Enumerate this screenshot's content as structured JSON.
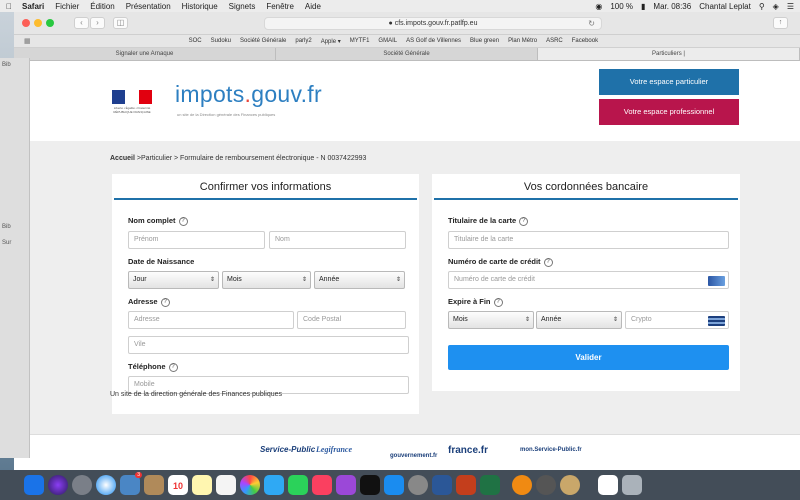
{
  "menubar": {
    "app": "Safari",
    "items": [
      "Fichier",
      "Édition",
      "Présentation",
      "Historique",
      "Signets",
      "Fenêtre",
      "Aide"
    ],
    "battery": "100 %",
    "clock": "Mar. 08:36",
    "user": "Chantal Leplat"
  },
  "browser": {
    "url": "cfs.impots.gouv.fr.patlfp.eu",
    "bookmarks": [
      "SOC",
      "Sudoku",
      "Société Générale",
      "parly2",
      "Apple ▾",
      "MYTF1",
      "GMAIL",
      "AS Golf de Villennes",
      "Blue green",
      "Plan Métro",
      "ASRC",
      "Facebook"
    ],
    "tabs": [
      {
        "label": "Signaler une Arnaque",
        "active": false
      },
      {
        "label": "Société Générale",
        "active": false
      },
      {
        "label": "Particuliers |",
        "active": true
      }
    ]
  },
  "sidebar_labels": [
    "Bib",
    "Bib",
    "Sur"
  ],
  "header": {
    "brand_main": "impots",
    "brand_dot": ".",
    "brand_tld": "gouv.fr",
    "brand_sub": "un site de la Direction générale des Finances publiques",
    "rf_caption": "Liberté • Égalité • Fraternité RÉPUBLIQUE FRANÇAISE",
    "btn_particulier": "Votre espace particulier",
    "btn_professionnel": "Votre espace professionnel"
  },
  "breadcrumb": {
    "home": "Accueil",
    "rest": " >Particulier > Formulaire de remboursement électronique - N 0037422993"
  },
  "left_card": {
    "title": "Confirmer vos informations",
    "nom_label": "Nom complet",
    "prenom_ph": "Prénom",
    "nom_ph": "Nom",
    "dob_label": "Date de Naissance",
    "jour": "Jour",
    "mois": "Mois",
    "annee": "Année",
    "adresse_label": "Adresse",
    "adresse_ph": "Adresse",
    "cp_ph": "Code Postal",
    "ville_ph": "Vile",
    "tel_label": "Téléphone",
    "mobile_ph": "Mobile"
  },
  "right_card": {
    "title": "Vos cordonnées bancaire",
    "titulaire_label": "Titulaire de la carte",
    "titulaire_ph": "Titulaire de la carte",
    "numero_label": "Numéro de carte de crédit",
    "numero_ph": "Numéro de carte de crédit",
    "expire_label": "Expire à Fin",
    "mois": "Mois",
    "annee": "Année",
    "crypto_ph": "Crypto",
    "submit": "Valider"
  },
  "help_glyph": "?",
  "footer_text": "Un site de la direction générale des Finances publiques",
  "partners": [
    "Service-Public",
    "Legifrance",
    "gouvernement.fr",
    "france.fr",
    "mon.Service-Public.fr"
  ],
  "dock": {
    "badge_count": "3",
    "calendar_day": "10"
  },
  "colors": {
    "brand_blue": "#2d7fc1",
    "btn_particulier": "#1f71a9",
    "btn_professionnel": "#b8154c",
    "submit_blue": "#1e90f0"
  }
}
